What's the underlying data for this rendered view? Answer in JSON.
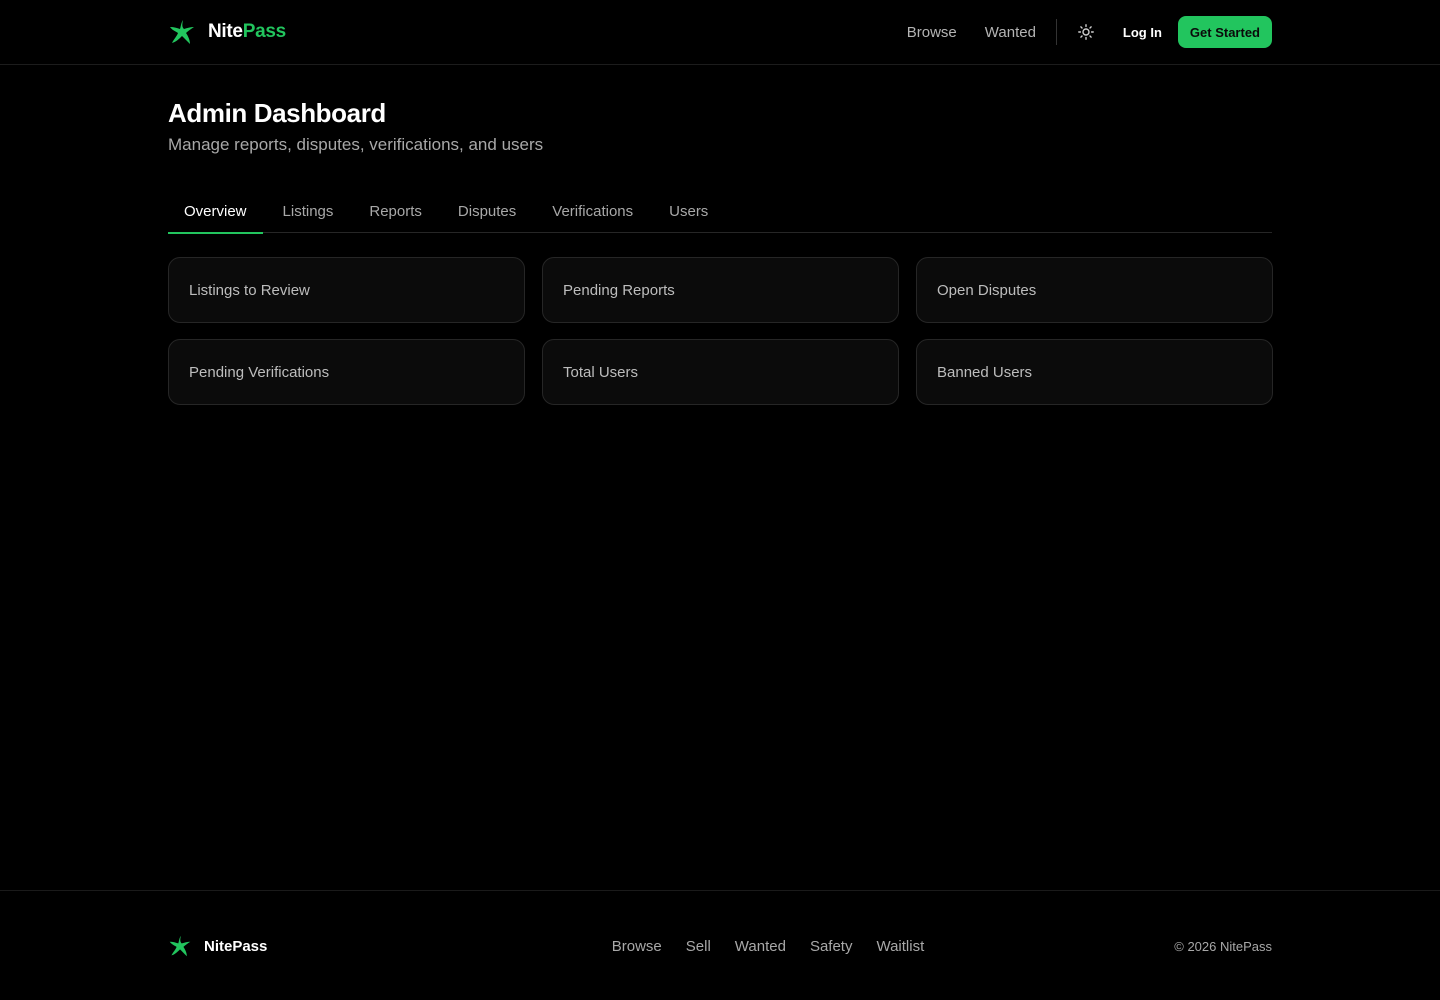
{
  "brand": {
    "name_primary": "Nite",
    "name_accent": "Pass",
    "accent_color": "#22c55e",
    "logo_icon": "star-logo-icon"
  },
  "header": {
    "nav": [
      "Browse",
      "Wanted"
    ],
    "theme_icon": "sun-icon",
    "login_label": "Log In",
    "cta_label": "Get Started"
  },
  "main": {
    "title": "Admin Dashboard",
    "subtitle": "Manage reports, disputes, verifications, and users",
    "tabs": [
      {
        "label": "Overview",
        "active": true
      },
      {
        "label": "Listings",
        "active": false
      },
      {
        "label": "Reports",
        "active": false
      },
      {
        "label": "Disputes",
        "active": false
      },
      {
        "label": "Verifications",
        "active": false
      },
      {
        "label": "Users",
        "active": false
      }
    ],
    "cards": [
      {
        "label": "Listings to Review"
      },
      {
        "label": "Pending Reports"
      },
      {
        "label": "Open Disputes"
      },
      {
        "label": "Pending Verifications"
      },
      {
        "label": "Total Users"
      },
      {
        "label": "Banned Users"
      }
    ]
  },
  "footer": {
    "brand_name": "NitePass",
    "links": [
      "Browse",
      "Sell",
      "Wanted",
      "Safety",
      "Waitlist"
    ],
    "copyright": "© 2026 NitePass"
  }
}
